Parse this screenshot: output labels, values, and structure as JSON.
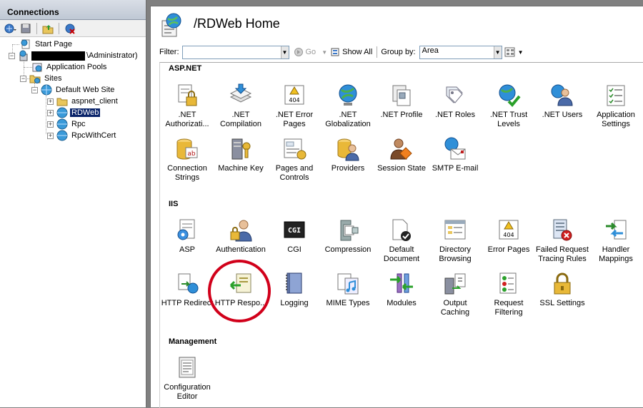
{
  "connections": {
    "header": "Connections",
    "tree": {
      "start_page": "Start Page",
      "server_suffix": "\\Administrator)",
      "app_pools": "Application Pools",
      "sites": "Sites",
      "default_web_site": "Default Web Site",
      "aspnet_client": "aspnet_client",
      "rdweb": "RDWeb",
      "rpc": "Rpc",
      "rpcwithcert": "RpcWithCert"
    }
  },
  "main": {
    "title": "/RDWeb Home",
    "filter_label": "Filter:",
    "go_label": "Go",
    "show_all_label": "Show All",
    "group_by_label": "Group by:",
    "group_by_value": "Area"
  },
  "groups": {
    "aspnet": "ASP.NET",
    "iis": "IIS",
    "management": "Management"
  },
  "features": {
    "aspnet": [
      ".NET Authorizati...",
      ".NET Compilation",
      ".NET Error Pages",
      ".NET Globalization",
      ".NET Profile",
      ".NET Roles",
      ".NET Trust Levels",
      ".NET Users",
      "Application Settings",
      "Connection Strings",
      "Machine Key",
      "Pages and Controls",
      "Providers",
      "Session State",
      "SMTP E-mail"
    ],
    "iis": [
      "ASP",
      "Authentication",
      "CGI",
      "Compression",
      "Default Document",
      "Directory Browsing",
      "Error Pages",
      "Failed Request Tracing Rules",
      "Handler Mappings",
      "HTTP Redirect",
      "HTTP Respo...",
      "Logging",
      "MIME Types",
      "Modules",
      "Output Caching",
      "Request Filtering",
      "SSL Settings"
    ],
    "management": [
      "Configuration Editor"
    ]
  },
  "icons": {
    "cgi_text": "CGI",
    "error_code": "404",
    "ab_text": "ab"
  },
  "colors": {
    "annotation": "#d1001a",
    "selection": "#0a246a"
  }
}
